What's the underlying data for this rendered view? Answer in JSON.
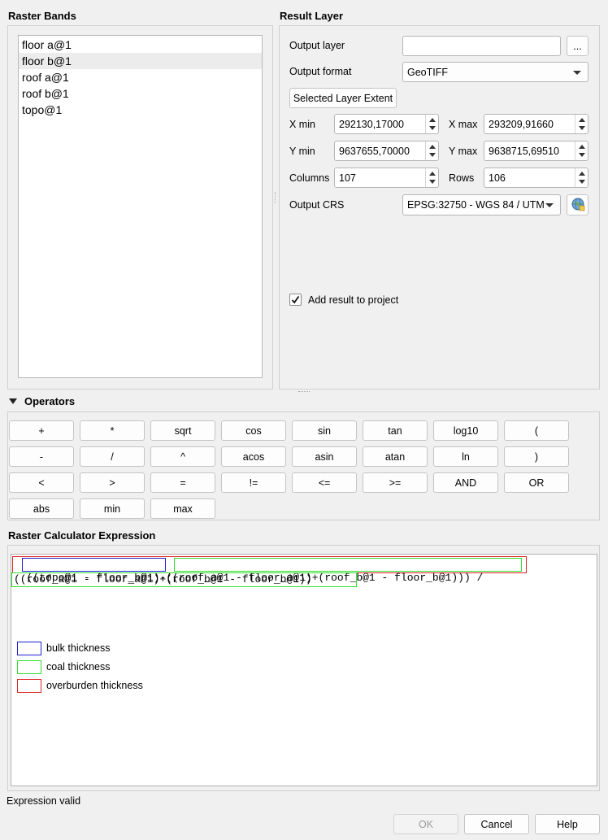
{
  "raster_bands": {
    "title": "Raster Bands",
    "items": [
      "floor a@1",
      "floor b@1",
      "roof a@1",
      "roof b@1",
      "topo@1"
    ],
    "selected_index": 1
  },
  "result_layer": {
    "title": "Result Layer",
    "output_layer_label": "Output layer",
    "output_layer_value": "",
    "browse_label": "...",
    "output_format_label": "Output format",
    "output_format_value": "GeoTIFF",
    "extent_button": "Selected Layer Extent",
    "xmin_label": "X min",
    "xmin_value": "292130,17000",
    "xmax_label": "X max",
    "xmax_value": "293209,91660",
    "ymin_label": "Y min",
    "ymin_value": "9637655,70000",
    "ymax_label": "Y max",
    "ymax_value": "9638715,69510",
    "columns_label": "Columns",
    "columns_value": "107",
    "rows_label": "Rows",
    "rows_value": "106",
    "crs_label": "Output CRS",
    "crs_value": "EPSG:32750 - WGS 84 / UTM",
    "add_result_label": "Add result to project",
    "add_result_checked": true
  },
  "operators": {
    "title": "Operators",
    "rows": [
      [
        "+",
        "*",
        "sqrt",
        "cos",
        "sin",
        "tan",
        "log10",
        "("
      ],
      [
        "-",
        "/",
        "^",
        "acos",
        "asin",
        "atan",
        "ln",
        ")"
      ],
      [
        "<",
        ">",
        "=",
        "!=",
        "<=",
        ">=",
        "AND",
        "OR"
      ],
      [
        "abs",
        "min",
        "max"
      ]
    ]
  },
  "expression": {
    "title": "Raster Calculator Expression",
    "line1_open": "((",
    "line1_bulk": "topo@1 - floor_b@1",
    "line1_close_bulk": ")",
    "line1_minus": "-",
    "line1_coal": "((roof_a@1 - floor_a@1)+(roof_b@1 - floor_b@1))",
    "line1_close": ")",
    "line1_div": " /",
    "line2_coal": "((roof_a@1 - floor_a@1)+(roof_b@1 - floor_b@1))",
    "legend": [
      {
        "label": "bulk thickness",
        "color": "#1f1fd6"
      },
      {
        "label": "coal thickness",
        "color": "#2ee02e"
      },
      {
        "label": "overburden thickness",
        "color": "#e02424"
      }
    ]
  },
  "status": {
    "text": "Expression valid"
  },
  "dialog_buttons": {
    "ok": "OK",
    "cancel": "Cancel",
    "help": "Help"
  }
}
